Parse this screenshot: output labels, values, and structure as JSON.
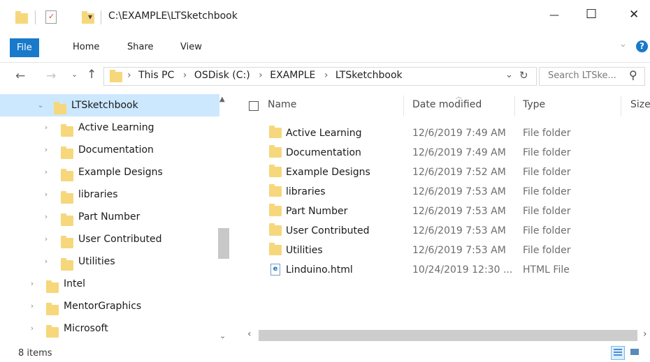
{
  "titlebar": {
    "path": "C:\\EXAMPLE\\LTSketchbook",
    "qat_dropdown": "▾",
    "min": "—",
    "max": "☐",
    "close": "✕"
  },
  "ribbon": {
    "tabs": [
      "File",
      "Home",
      "Share",
      "View"
    ],
    "expand": "⌄",
    "help": "?"
  },
  "address": {
    "crumbs": [
      "This PC",
      "OSDisk (C:)",
      "EXAMPLE",
      "LTSketchbook"
    ],
    "sep": "›",
    "search_placeholder": "Search LTSke...",
    "dropdown": "⌄",
    "refresh": "↻",
    "search_icon": "⚲"
  },
  "nav": {
    "items": [
      {
        "label": "LTSketchbook",
        "expanded": true,
        "selected": true
      },
      {
        "label": "Active Learning"
      },
      {
        "label": "Documentation"
      },
      {
        "label": "Example Designs"
      },
      {
        "label": "libraries"
      },
      {
        "label": "Part Number"
      },
      {
        "label": "User Contributed"
      },
      {
        "label": "Utilities"
      },
      {
        "label": "Intel"
      },
      {
        "label": "MentorGraphics"
      },
      {
        "label": "Microsoft"
      }
    ]
  },
  "columns": {
    "name": "Name",
    "date": "Date modified",
    "type": "Type",
    "size": "Size"
  },
  "files": [
    {
      "name": "Active Learning",
      "date": "12/6/2019 7:49 AM",
      "type": "File folder",
      "icon": "folder"
    },
    {
      "name": "Documentation",
      "date": "12/6/2019 7:49 AM",
      "type": "File folder",
      "icon": "folder"
    },
    {
      "name": "Example Designs",
      "date": "12/6/2019 7:52 AM",
      "type": "File folder",
      "icon": "folder"
    },
    {
      "name": "libraries",
      "date": "12/6/2019 7:53 AM",
      "type": "File folder",
      "icon": "folder"
    },
    {
      "name": "Part Number",
      "date": "12/6/2019 7:53 AM",
      "type": "File folder",
      "icon": "folder"
    },
    {
      "name": "User Contributed",
      "date": "12/6/2019 7:53 AM",
      "type": "File folder",
      "icon": "folder"
    },
    {
      "name": "Utilities",
      "date": "12/6/2019 7:53 AM",
      "type": "File folder",
      "icon": "folder"
    },
    {
      "name": "Linduino.html",
      "date": "10/24/2019 12:30 ...",
      "type": "HTML File",
      "icon": "html"
    }
  ],
  "status": {
    "count": "8 items"
  },
  "colors": {
    "accent": "#1979ca",
    "selection": "#cce8ff",
    "folder": "#f6d77c"
  }
}
